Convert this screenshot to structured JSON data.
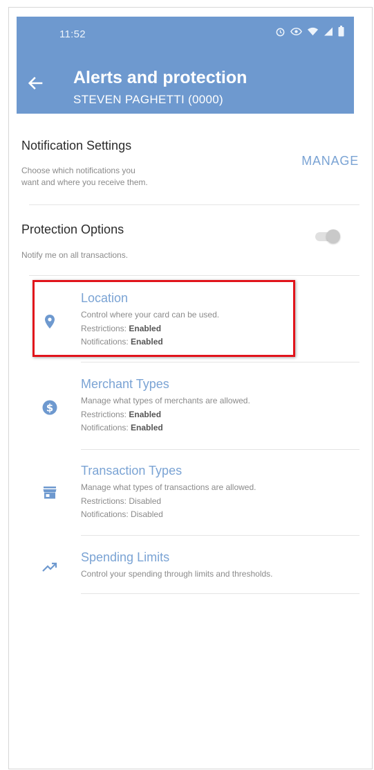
{
  "status_bar": {
    "time": "11:52",
    "icons": [
      "alarm-icon",
      "eye-icon",
      "wifi-icon",
      "signal-icon",
      "battery-icon"
    ]
  },
  "header": {
    "title": "Alerts and protection",
    "subtitle": "STEVEN PAGHETTI (0000)",
    "back_icon": "arrow-left-icon",
    "background_color": "#6e99cf"
  },
  "notification_settings": {
    "title": "Notification Settings",
    "description_line1": "Choose which notifications you",
    "description_line2": "want and where you receive them.",
    "action_label": "MANAGE"
  },
  "protection_options": {
    "title": "Protection Options",
    "description": "Notify me on all transactions.",
    "toggle_on": false
  },
  "options": [
    {
      "icon": "location-pin-icon",
      "title": "Location",
      "description": "Control where your card can be used.",
      "restrictions_label": "Restrictions:",
      "restrictions_value": "Enabled",
      "notifications_label": "Notifications:",
      "notifications_value": "Enabled",
      "highlighted": true
    },
    {
      "icon": "dollar-circle-icon",
      "title": "Merchant Types",
      "description": "Manage what types of merchants are allowed.",
      "restrictions_label": "Restrictions:",
      "restrictions_value": "Enabled",
      "notifications_label": "Notifications:",
      "notifications_value": "Enabled"
    },
    {
      "icon": "storefront-icon",
      "title": "Transaction Types",
      "description": "Manage what types of transactions are allowed.",
      "restrictions_label": "Restrictions:",
      "restrictions_value": "Disabled",
      "notifications_label": "Notifications:",
      "notifications_value": "Disabled"
    },
    {
      "icon": "trending-up-icon",
      "title": "Spending Limits",
      "description": "Control your spending through limits and thresholds."
    }
  ],
  "colors": {
    "accent": "#7aa3d4",
    "highlight_border": "#e1141b",
    "icon": "#6e99cf"
  }
}
